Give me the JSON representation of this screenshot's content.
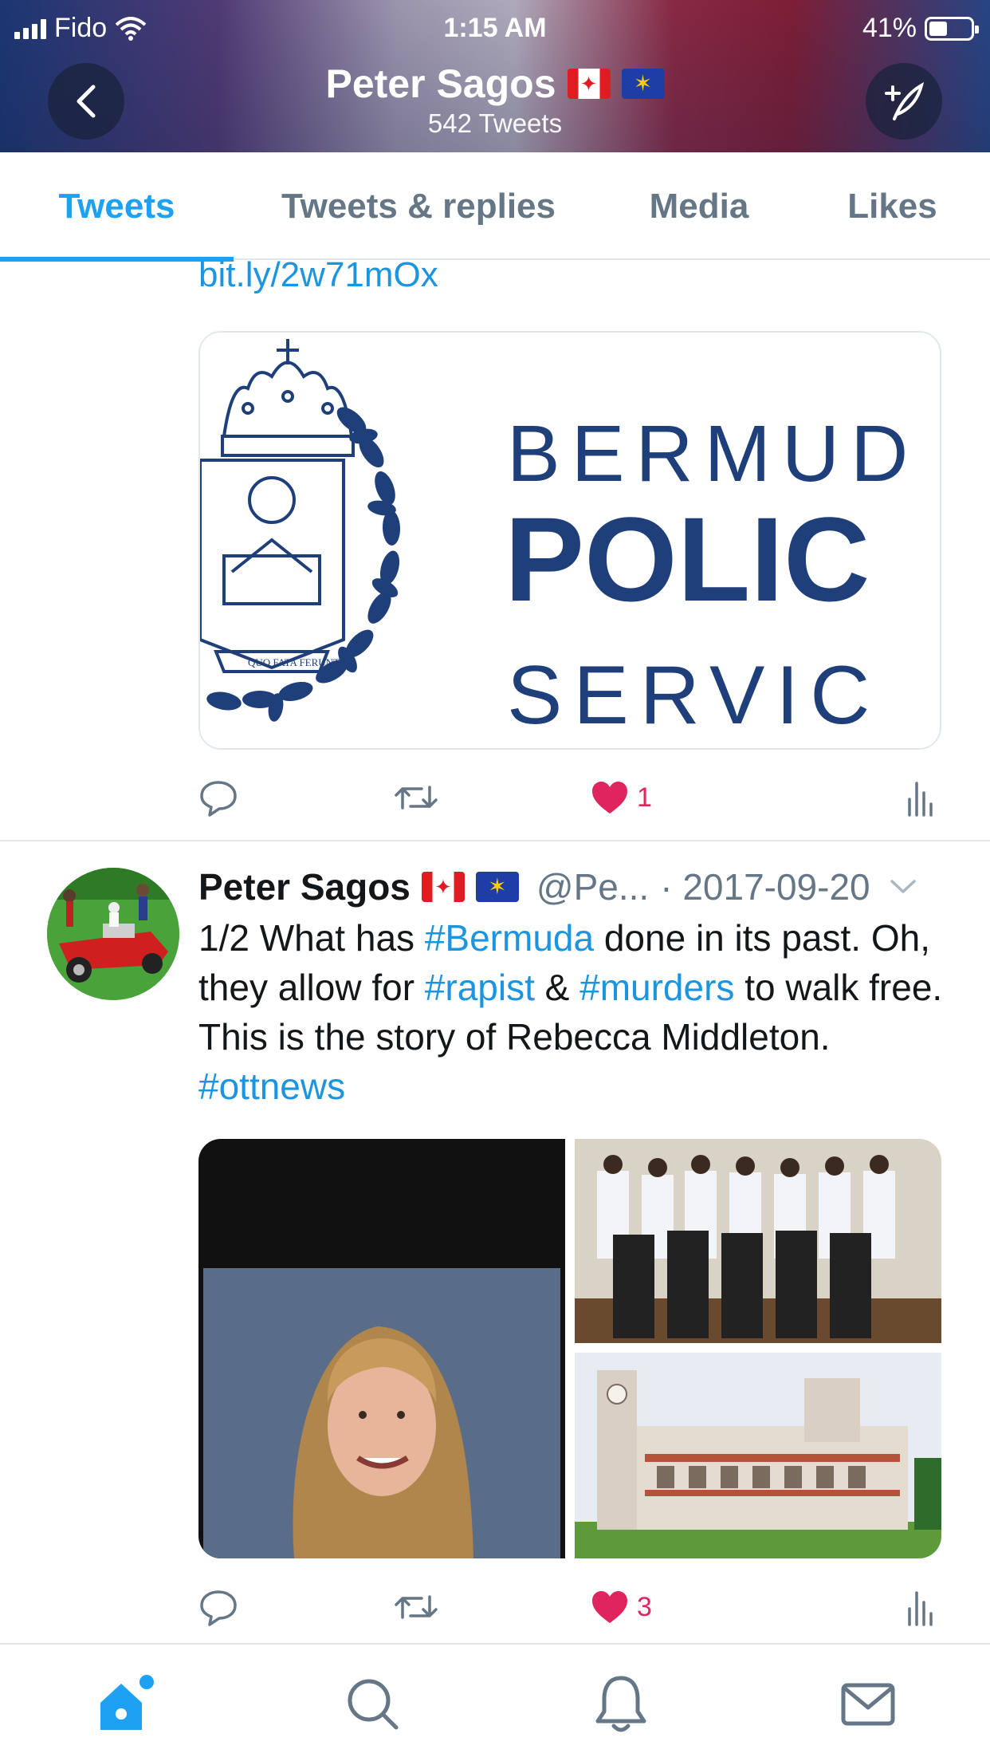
{
  "status_bar": {
    "carrier": "Fido",
    "time": "1:15 AM",
    "battery": "41%"
  },
  "header": {
    "name": "Peter Sagos",
    "tweet_count": "542 Tweets"
  },
  "tabs": [
    {
      "label": "Tweets",
      "active": true
    },
    {
      "label": "Tweets & replies",
      "active": false
    },
    {
      "label": "Media",
      "active": false
    },
    {
      "label": "Likes",
      "active": false
    }
  ],
  "tweet1": {
    "link": "bit.ly/2w71mOx",
    "card": {
      "line1": "BERMUD",
      "line2": "POLIC",
      "line3": "SERVIC",
      "motto": "QUO FATA FERUNT"
    },
    "likes": "1"
  },
  "tweet2": {
    "name": "Peter Sagos",
    "handle": "@Pe...",
    "date": "· 2017-09-20",
    "text_1": "1/2 What has ",
    "tag_1": "#Bermuda",
    "text_2": " done in its past. Oh, they allow for ",
    "tag_2": "#rapist",
    "text_3": " & ",
    "tag_3": "#murders",
    "text_4": " to walk free. This is the story of Rebecca Middleton. ",
    "tag_4": "#ottnews",
    "likes": "3"
  },
  "colors": {
    "accent": "#1da1f2",
    "like": "#e0245e",
    "muted": "#657786"
  },
  "icons": [
    "back-icon",
    "compose-icon",
    "reply-icon",
    "retweet-icon",
    "heart-icon",
    "analytics-icon",
    "home-icon",
    "search-icon",
    "notifications-icon",
    "messages-icon"
  ]
}
